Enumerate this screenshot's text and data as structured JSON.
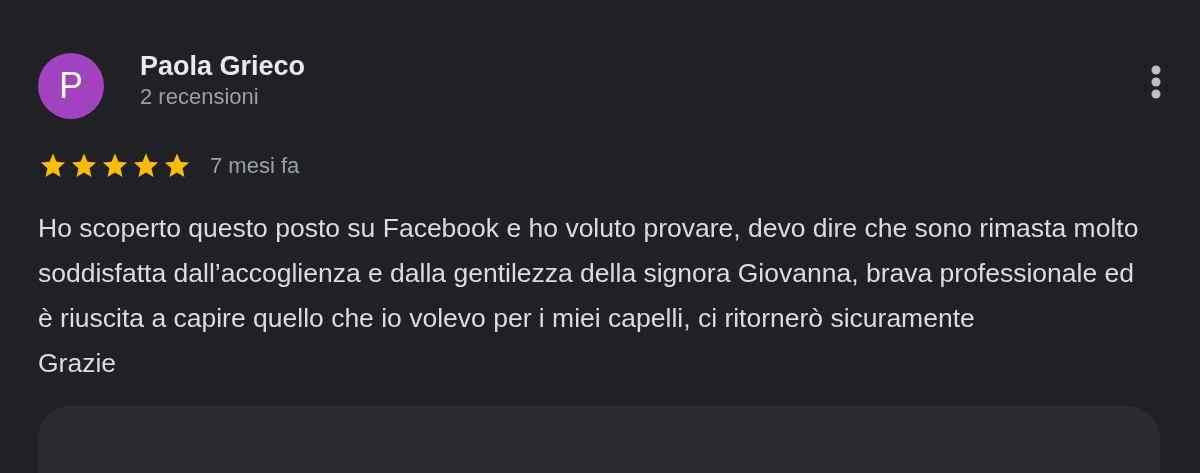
{
  "review": {
    "author": {
      "initial": "P",
      "name": "Paola Grieco",
      "review_count": "2 recensioni",
      "color": "#a142c1"
    },
    "stars": 5,
    "time": "7 mesi fa",
    "text": "Ho scoperto questo posto su Facebook e ho voluto provare, devo dire che sono rimasta molto soddisfatta dall’accoglienza e dalla gentilezza della signora Giovanna, brava professionale ed è riuscita a capire quello che io volevo per i miei capelli, ci ritornerò sicuramente\nGrazie"
  }
}
